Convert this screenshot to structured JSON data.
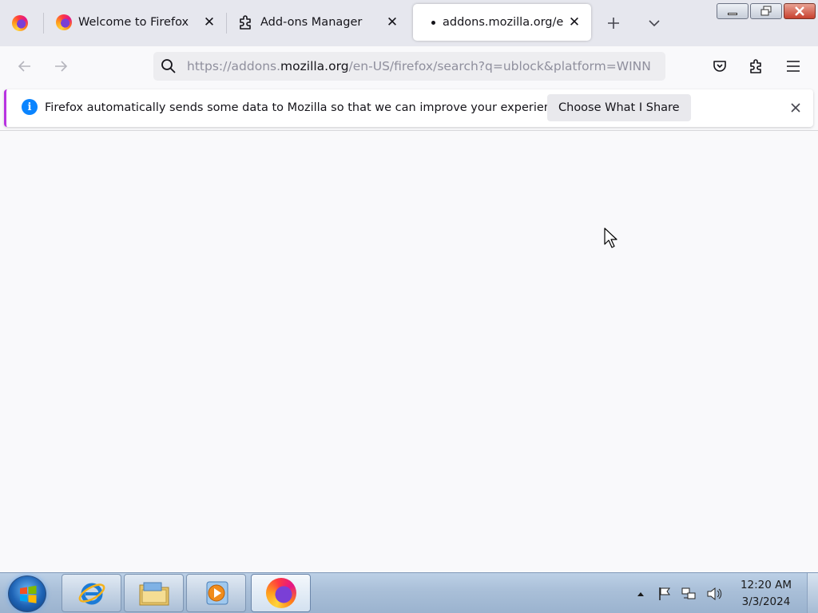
{
  "browser": {
    "tabs": [
      {
        "label": "Welcome to Firefox",
        "icon": "firefox-icon",
        "active": false
      },
      {
        "label": "Add-ons Manager",
        "icon": "puzzle-piece-icon",
        "active": false
      },
      {
        "label": "addons.mozilla.org/en",
        "icon": "loading-dot-icon",
        "active": true
      }
    ],
    "url": {
      "prefix": "https://addons.",
      "host": "mozilla.org",
      "suffix": "/en-US/firefox/search?q=ublock&platform=WINN"
    },
    "notification": {
      "message": "Firefox automatically sends some data to Mozilla so that we can improve your experience.",
      "button_label": "Choose What I Share"
    }
  },
  "taskbar": {
    "pinned": [
      "internet-explorer-icon",
      "windows-explorer-icon",
      "media-player-icon",
      "firefox-icon"
    ],
    "clock": {
      "time": "12:20 AM",
      "date": "3/3/2024"
    }
  },
  "colors": {
    "accent": "#0a84ff",
    "notification_stripe": "#b833e1",
    "window_close": "#c8412f"
  }
}
